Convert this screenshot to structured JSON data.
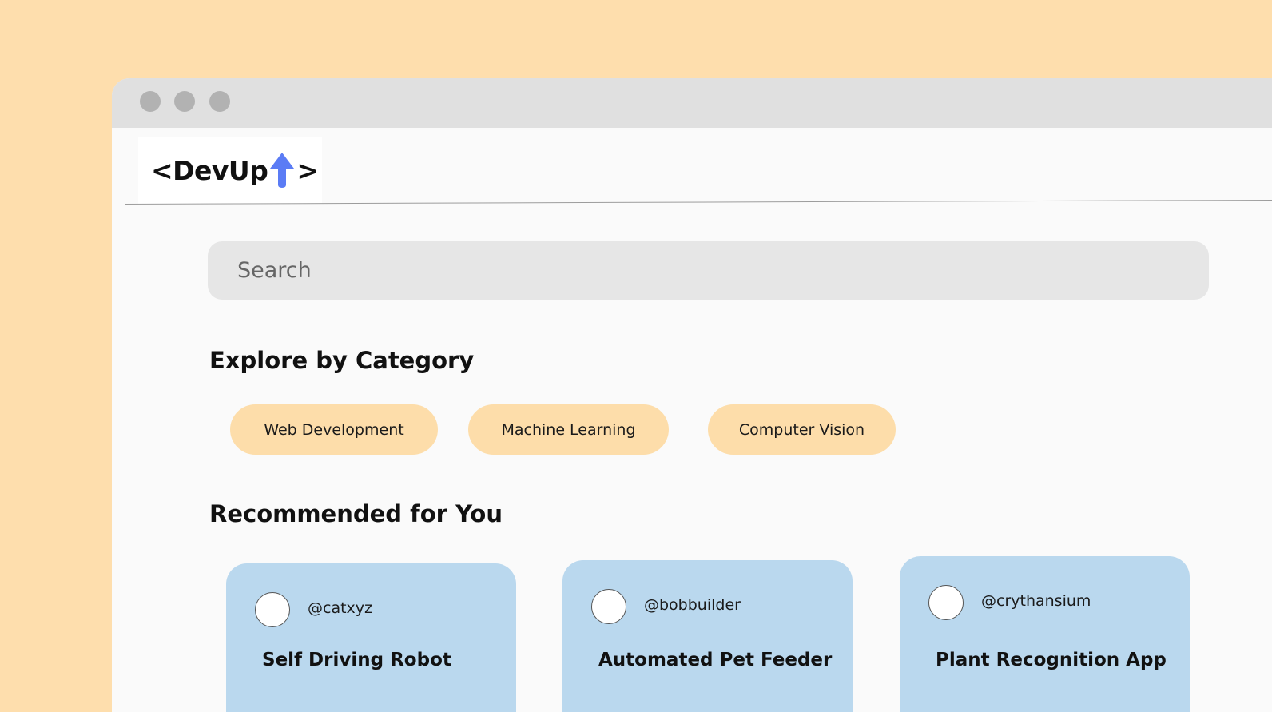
{
  "app": {
    "logo_left": "<DevUp",
    "logo_right": ">",
    "logo_arrow_color": "#5B7CF5"
  },
  "colors": {
    "background": "#FEDEAD",
    "titlebar": "#E0E0E0",
    "page": "#FAFAFA",
    "search_bg": "#E6E6E6",
    "category_pill": "#FDDDAA",
    "card": "#BAD8EE"
  },
  "search": {
    "placeholder": "Search",
    "value": ""
  },
  "categories": {
    "title": "Explore by Category",
    "items": [
      {
        "label": "Web Development"
      },
      {
        "label": "Machine Learning"
      },
      {
        "label": "Computer Vision"
      }
    ]
  },
  "recommended": {
    "title": "Recommended for You",
    "cards": [
      {
        "username": "@catxyz",
        "title": "Self Driving Robot"
      },
      {
        "username": "@bobbuilder",
        "title": "Automated Pet Feeder"
      },
      {
        "username": "@crythansium",
        "title": "Plant Recognition App"
      }
    ]
  }
}
